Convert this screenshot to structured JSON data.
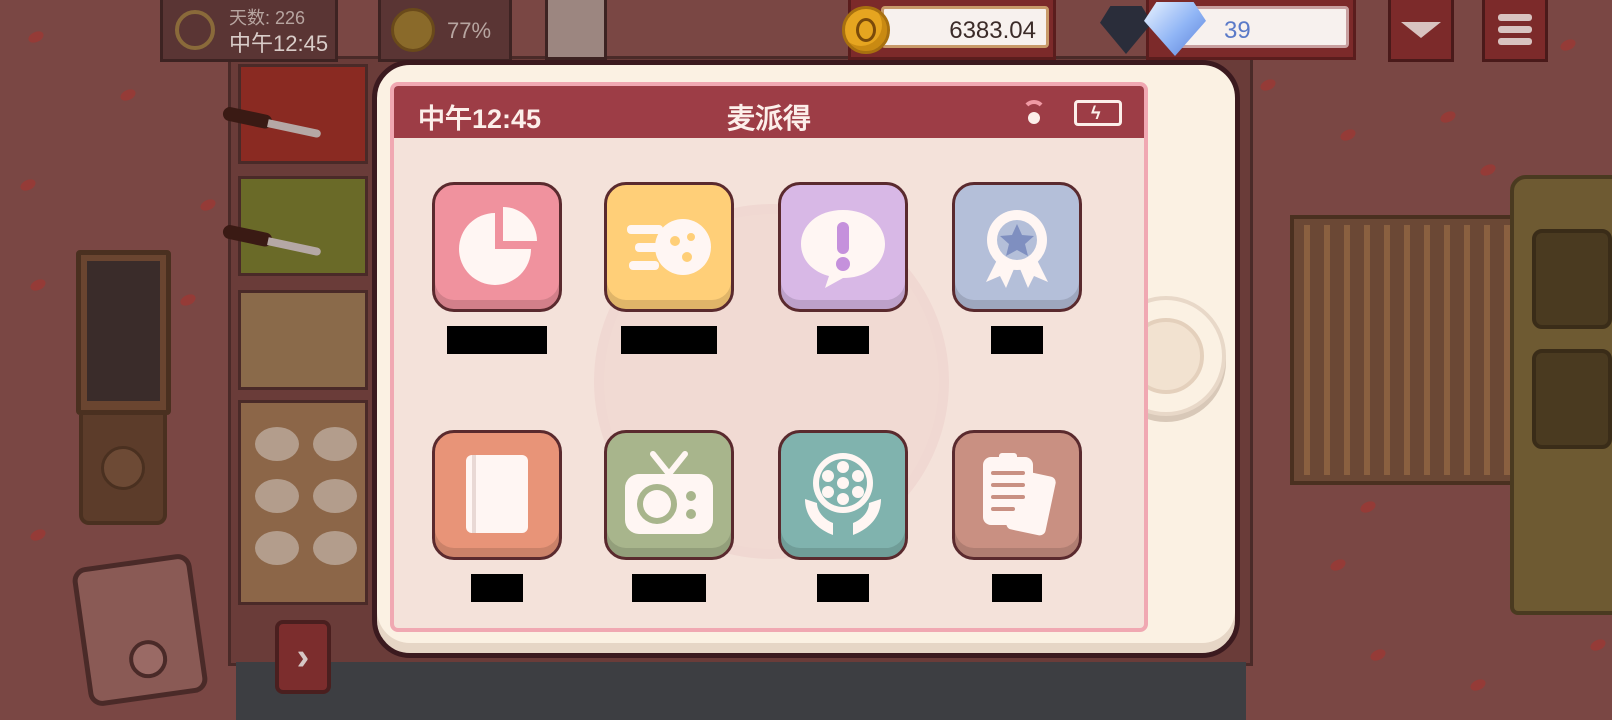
{
  "hud": {
    "days_label": "天数: 226",
    "time": "中午12:45",
    "mood_percent": "77%",
    "coins": "6383.04",
    "gems": "39"
  },
  "phone": {
    "status_time": "中午12:45",
    "title": "麦派得",
    "apps": [
      {
        "name": "stats",
        "label": "",
        "icon": "pie-chart-icon",
        "color": "#f0929e"
      },
      {
        "name": "delivery",
        "label": "",
        "icon": "speed-pizza-icon",
        "color": "#ffcf78"
      },
      {
        "name": "notices",
        "label": "",
        "icon": "exclamation-bubble-icon",
        "color": "#d8b8e6"
      },
      {
        "name": "achievements",
        "label": "",
        "icon": "ribbon-star-icon",
        "color": "#b4bfd9"
      },
      {
        "name": "recipes",
        "label": "",
        "icon": "book-icon",
        "color": "#e89478"
      },
      {
        "name": "tv",
        "label": "",
        "icon": "tv-pizza-icon",
        "color": "#a8b58c"
      },
      {
        "name": "cinema",
        "label": "",
        "icon": "film-reel-hands-icon",
        "color": "#80b3ae"
      },
      {
        "name": "documents",
        "label": "",
        "icon": "clipboard-papers-icon",
        "color": "#c99082"
      }
    ]
  }
}
